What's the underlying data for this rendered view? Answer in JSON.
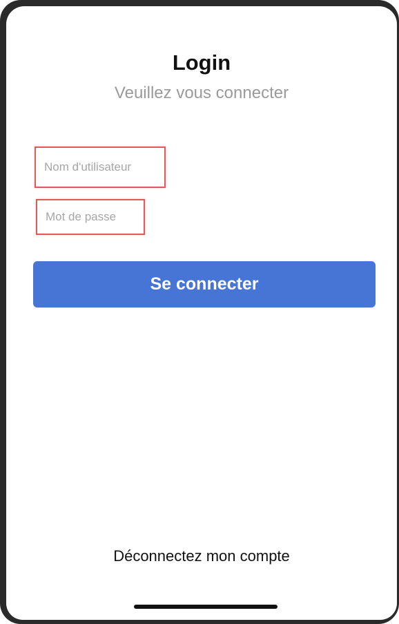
{
  "header": {
    "title": "Login",
    "subtitle": "Veuillez vous connecter"
  },
  "form": {
    "username": {
      "placeholder": "Nom d'utilisateur",
      "value": ""
    },
    "password": {
      "placeholder": "Mot de passe",
      "value": ""
    },
    "submit_label": "Se connecter"
  },
  "footer": {
    "logout_label": "Déconnectez mon compte"
  },
  "colors": {
    "accent": "#4675d6",
    "highlight_border": "#e05a5a",
    "subtitle": "#9a9a9a"
  }
}
